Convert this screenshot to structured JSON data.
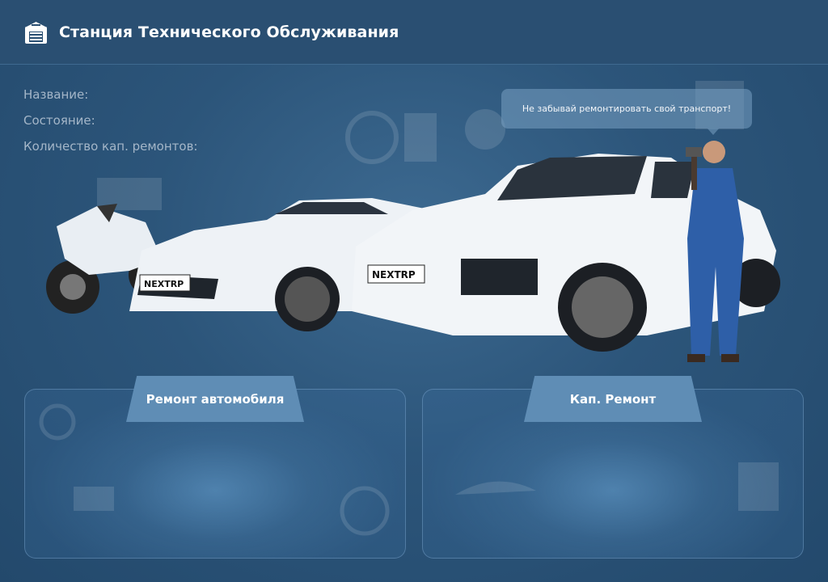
{
  "header": {
    "title": "Станция Технического Обслуживания",
    "icon": "garage-icon"
  },
  "info": {
    "name_label": "Название:",
    "state_label": "Состояние:",
    "repairs_count_label": "Количество кап. ремонтов:"
  },
  "bubble": {
    "text": "Не забывай ремонтировать свой транспорт!"
  },
  "vehicles": {
    "plate_text": "NEXTRP"
  },
  "actions": {
    "repair_label": "Ремонт автомобиля",
    "overhaul_label": "Кап. Ремонт"
  },
  "colors": {
    "background": "#2c557a",
    "header": "#2a4f72",
    "tab": "#5f8db5",
    "label": "#a4b6c8"
  }
}
